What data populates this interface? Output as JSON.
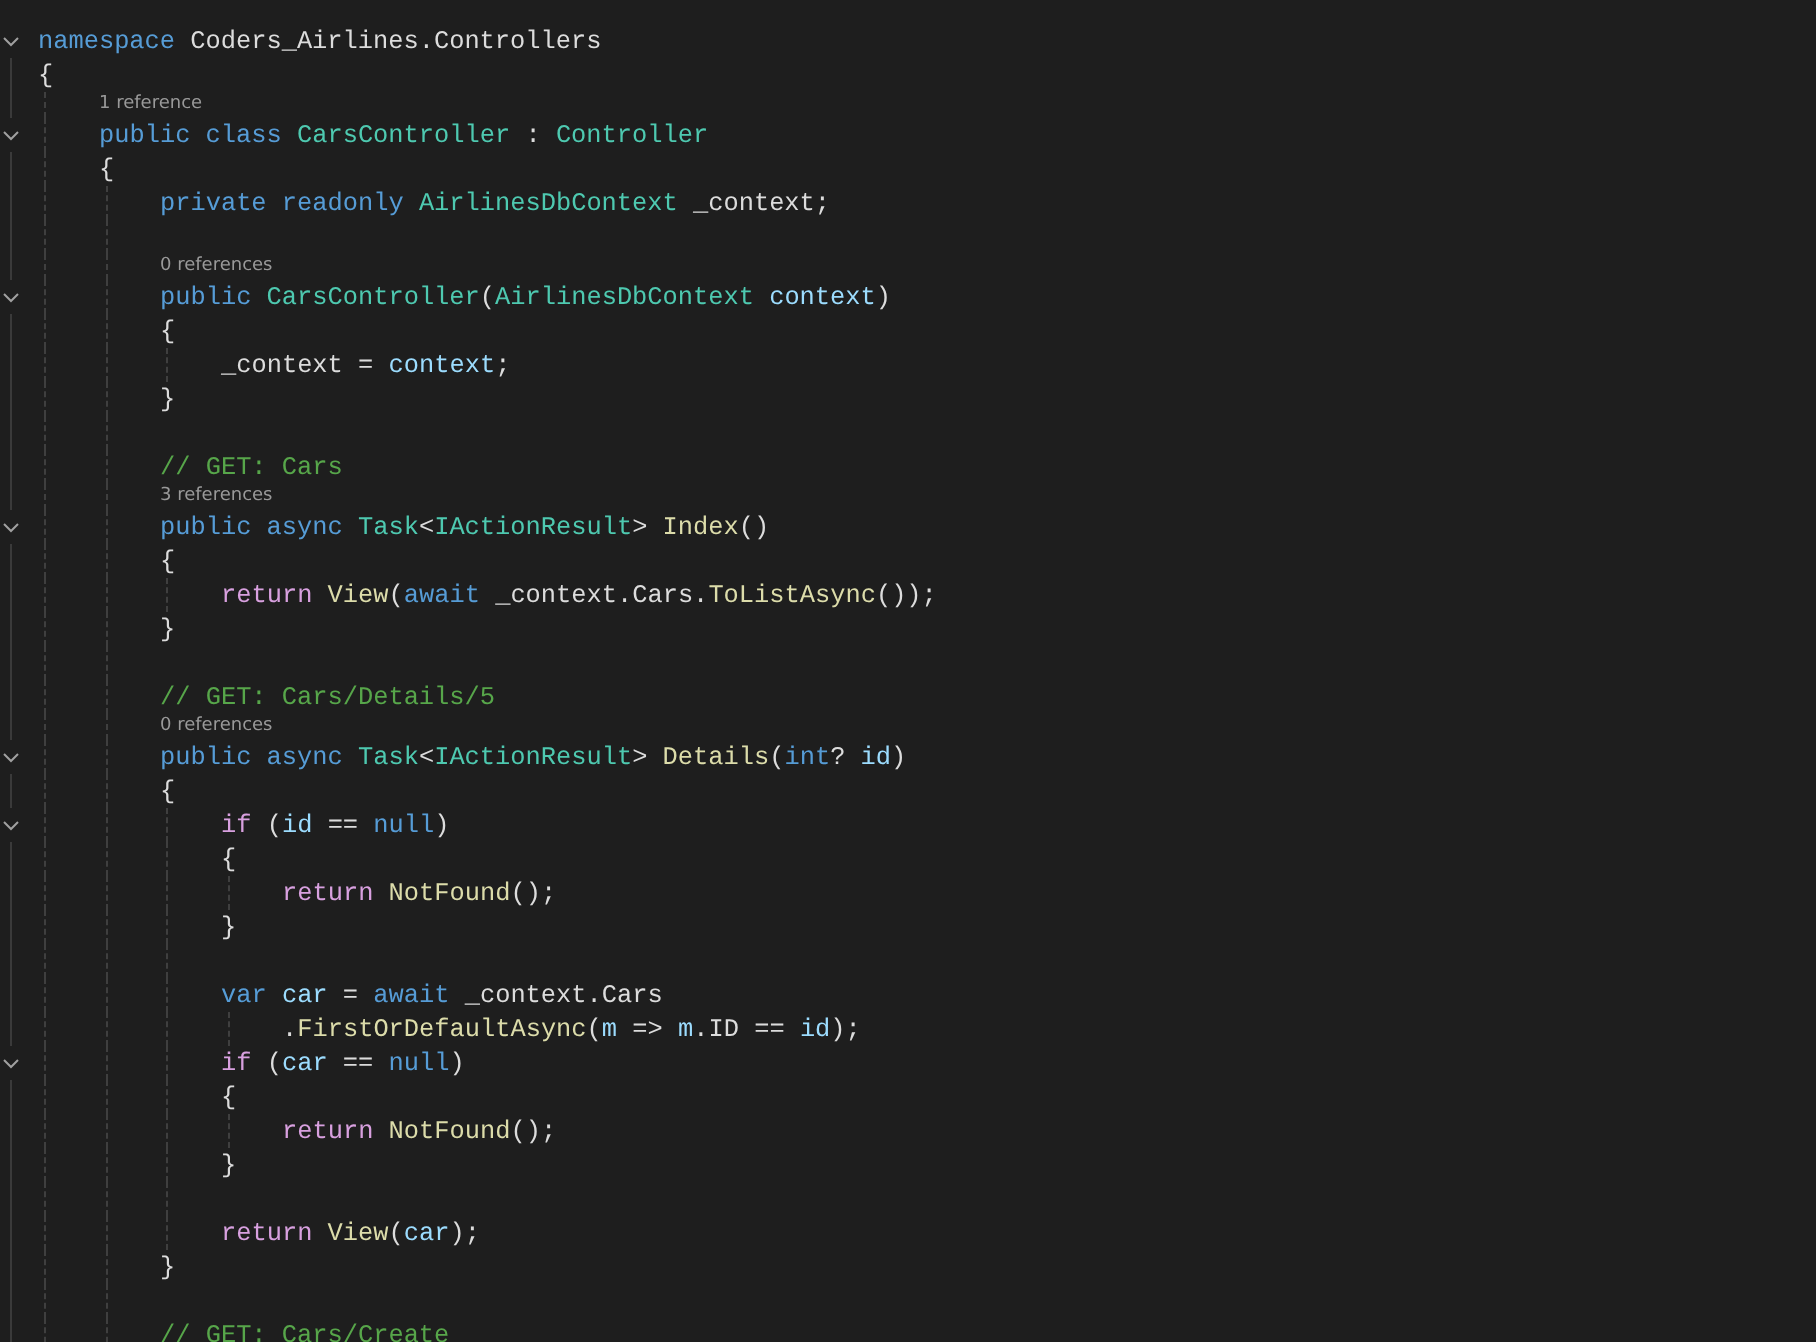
{
  "editor": {
    "lines": [
      {
        "kind": "code",
        "expanded": true,
        "tokens": [
          {
            "t": "namespace",
            "kind": "kw"
          },
          {
            "t": " Coders_Airlines.Controllers",
            "kind": "txt"
          }
        ]
      },
      {
        "kind": "code",
        "tokens": [
          {
            "t": "{",
            "kind": "txt"
          }
        ]
      },
      {
        "kind": "lens",
        "text": "    1 reference"
      },
      {
        "kind": "code",
        "expanded": true,
        "tokens": [
          {
            "t": "    public class",
            "kind": "kw"
          },
          {
            "t": " CarsController",
            "kind": "type"
          },
          {
            "t": " : ",
            "kind": "txt"
          },
          {
            "t": "Controller",
            "kind": "type"
          }
        ]
      },
      {
        "kind": "code",
        "tokens": [
          {
            "t": "    {",
            "kind": "txt"
          }
        ]
      },
      {
        "kind": "code",
        "tokens": [
          {
            "t": "        private readonly",
            "kind": "kw"
          },
          {
            "t": " AirlinesDbContext",
            "kind": "type"
          },
          {
            "t": " _context;",
            "kind": "txt"
          }
        ]
      },
      {
        "kind": "blank"
      },
      {
        "kind": "lens",
        "text": "        0 references"
      },
      {
        "kind": "code",
        "expanded": true,
        "tokens": [
          {
            "t": "        public",
            "kind": "kw"
          },
          {
            "t": " CarsController",
            "kind": "type"
          },
          {
            "t": "(",
            "kind": "txt"
          },
          {
            "t": "AirlinesDbContext",
            "kind": "type"
          },
          {
            "t": " context",
            "kind": "var"
          },
          {
            "t": ")",
            "kind": "txt"
          }
        ]
      },
      {
        "kind": "code",
        "tokens": [
          {
            "t": "        {",
            "kind": "txt"
          }
        ]
      },
      {
        "kind": "code",
        "tokens": [
          {
            "t": "            _context = ",
            "kind": "txt"
          },
          {
            "t": "context",
            "kind": "var"
          },
          {
            "t": ";",
            "kind": "txt"
          }
        ]
      },
      {
        "kind": "code",
        "tokens": [
          {
            "t": "        }",
            "kind": "txt"
          }
        ]
      },
      {
        "kind": "blank"
      },
      {
        "kind": "code",
        "tokens": [
          {
            "t": "        // GET: Cars",
            "kind": "com"
          }
        ]
      },
      {
        "kind": "lens",
        "text": "        3 references"
      },
      {
        "kind": "code",
        "expanded": true,
        "tokens": [
          {
            "t": "        public async",
            "kind": "kw"
          },
          {
            "t": " Task",
            "kind": "type"
          },
          {
            "t": "<",
            "kind": "txt"
          },
          {
            "t": "IActionResult",
            "kind": "type"
          },
          {
            "t": "> ",
            "kind": "txt"
          },
          {
            "t": "Index",
            "kind": "fn"
          },
          {
            "t": "()",
            "kind": "txt"
          }
        ]
      },
      {
        "kind": "code",
        "tokens": [
          {
            "t": "        {",
            "kind": "txt"
          }
        ]
      },
      {
        "kind": "code",
        "tokens": [
          {
            "t": "            return",
            "kind": "ctl"
          },
          {
            "t": " View",
            "kind": "fn"
          },
          {
            "t": "(",
            "kind": "txt"
          },
          {
            "t": "await",
            "kind": "kw"
          },
          {
            "t": " _context.Cars.",
            "kind": "txt"
          },
          {
            "t": "ToListAsync",
            "kind": "fn"
          },
          {
            "t": "());",
            "kind": "txt"
          }
        ]
      },
      {
        "kind": "code",
        "tokens": [
          {
            "t": "        }",
            "kind": "txt"
          }
        ]
      },
      {
        "kind": "blank"
      },
      {
        "kind": "code",
        "tokens": [
          {
            "t": "        // GET: Cars/Details/5",
            "kind": "com"
          }
        ]
      },
      {
        "kind": "lens",
        "text": "        0 references"
      },
      {
        "kind": "code",
        "expanded": true,
        "tokens": [
          {
            "t": "        public async",
            "kind": "kw"
          },
          {
            "t": " Task",
            "kind": "type"
          },
          {
            "t": "<",
            "kind": "txt"
          },
          {
            "t": "IActionResult",
            "kind": "type"
          },
          {
            "t": "> ",
            "kind": "txt"
          },
          {
            "t": "Details",
            "kind": "fn"
          },
          {
            "t": "(",
            "kind": "txt"
          },
          {
            "t": "int",
            "kind": "kw"
          },
          {
            "t": "? ",
            "kind": "txt"
          },
          {
            "t": "id",
            "kind": "var"
          },
          {
            "t": ")",
            "kind": "txt"
          }
        ]
      },
      {
        "kind": "code",
        "tokens": [
          {
            "t": "        {",
            "kind": "txt"
          }
        ]
      },
      {
        "kind": "code",
        "expanded": true,
        "tokens": [
          {
            "t": "            if",
            "kind": "ctl"
          },
          {
            "t": " (",
            "kind": "txt"
          },
          {
            "t": "id",
            "kind": "var"
          },
          {
            "t": " == ",
            "kind": "txt"
          },
          {
            "t": "null",
            "kind": "kw"
          },
          {
            "t": ")",
            "kind": "txt"
          }
        ]
      },
      {
        "kind": "code",
        "tokens": [
          {
            "t": "            {",
            "kind": "txt"
          }
        ]
      },
      {
        "kind": "code",
        "tokens": [
          {
            "t": "                return",
            "kind": "ctl"
          },
          {
            "t": " NotFound",
            "kind": "fn"
          },
          {
            "t": "();",
            "kind": "txt"
          }
        ]
      },
      {
        "kind": "code",
        "tokens": [
          {
            "t": "            }",
            "kind": "txt"
          }
        ]
      },
      {
        "kind": "blank"
      },
      {
        "kind": "code",
        "tokens": [
          {
            "t": "            var",
            "kind": "kw"
          },
          {
            "t": " car",
            "kind": "var"
          },
          {
            "t": " = ",
            "kind": "txt"
          },
          {
            "t": "await",
            "kind": "kw"
          },
          {
            "t": " _context.Cars",
            "kind": "txt"
          }
        ]
      },
      {
        "kind": "code",
        "tokens": [
          {
            "t": "                .",
            "kind": "txt"
          },
          {
            "t": "FirstOrDefaultAsync",
            "kind": "fn"
          },
          {
            "t": "(",
            "kind": "txt"
          },
          {
            "t": "m",
            "kind": "var"
          },
          {
            "t": " => ",
            "kind": "txt"
          },
          {
            "t": "m",
            "kind": "var"
          },
          {
            "t": ".ID == ",
            "kind": "txt"
          },
          {
            "t": "id",
            "kind": "var"
          },
          {
            "t": ");",
            "kind": "txt"
          }
        ]
      },
      {
        "kind": "code",
        "expanded": true,
        "tokens": [
          {
            "t": "            if",
            "kind": "ctl"
          },
          {
            "t": " (",
            "kind": "txt"
          },
          {
            "t": "car",
            "kind": "var"
          },
          {
            "t": " == ",
            "kind": "txt"
          },
          {
            "t": "null",
            "kind": "kw"
          },
          {
            "t": ")",
            "kind": "txt"
          }
        ]
      },
      {
        "kind": "code",
        "tokens": [
          {
            "t": "            {",
            "kind": "txt"
          }
        ]
      },
      {
        "kind": "code",
        "tokens": [
          {
            "t": "                return",
            "kind": "ctl"
          },
          {
            "t": " NotFound",
            "kind": "fn"
          },
          {
            "t": "();",
            "kind": "txt"
          }
        ]
      },
      {
        "kind": "code",
        "tokens": [
          {
            "t": "            }",
            "kind": "txt"
          }
        ]
      },
      {
        "kind": "blank"
      },
      {
        "kind": "code",
        "tokens": [
          {
            "t": "            return",
            "kind": "ctl"
          },
          {
            "t": " View",
            "kind": "fn"
          },
          {
            "t": "(",
            "kind": "txt"
          },
          {
            "t": "car",
            "kind": "var"
          },
          {
            "t": ");",
            "kind": "txt"
          }
        ]
      },
      {
        "kind": "code",
        "tokens": [
          {
            "t": "        }",
            "kind": "txt"
          }
        ]
      },
      {
        "kind": "blank"
      },
      {
        "kind": "code",
        "tokens": [
          {
            "t": "        // GET: Cars/Create",
            "kind": "com"
          }
        ]
      }
    ]
  }
}
